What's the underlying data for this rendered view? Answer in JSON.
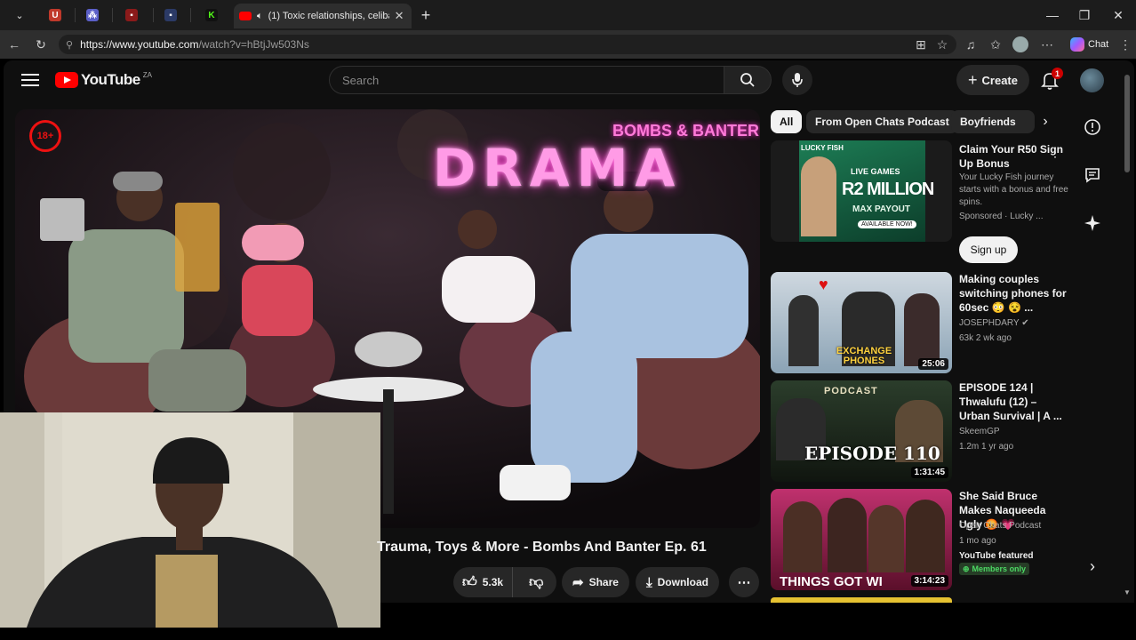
{
  "browser": {
    "active_tab_title": "(1) Toxic relationships, celiba",
    "url_host": "https://www.youtube.com",
    "url_path": "/watch?v=hBtjJw503Ns",
    "chat_label": "Chat",
    "pinned_tabs": [
      {
        "icon": "u-icon",
        "glyph": "U",
        "color": "#c0392b"
      },
      {
        "icon": "teams-icon",
        "glyph": "⁂",
        "color": "#5b5fc7"
      },
      {
        "icon": "red-app-icon",
        "glyph": "▪",
        "color": "#8b1a1a"
      },
      {
        "icon": "blue-app-icon",
        "glyph": "▪",
        "color": "#2b3a66"
      },
      {
        "icon": "kick-icon",
        "glyph": "K",
        "color": "#53fc18"
      }
    ]
  },
  "youtube": {
    "logo_text": "YouTube",
    "region": "ZA",
    "search_placeholder": "Search",
    "create_label": "Create",
    "notification_count": "1",
    "video": {
      "title": "Trauma, Toys & More - Bombs And Banter Ep. 61",
      "like_count": "5.3k",
      "share_label": "Share",
      "download_label": "Download",
      "thumb_badge": "18+",
      "thumb_headline": "DRAMA",
      "thumb_brand": "BOMBS & BANTER"
    },
    "chips": [
      "All",
      "From Open Chats Podcast",
      "Boyfriends"
    ],
    "recommendations": [
      {
        "title": "Claim Your R50 Sign Up Bonus",
        "meta1": "Your Lucky Fish journey starts with a bonus and free spins.",
        "meta2": "Sponsored · Lucky ...",
        "cta": "Sign up",
        "thumb_text_1": "LIVE GAMES",
        "thumb_text_2": "R2 MILLION",
        "thumb_text_3": "MAX PAYOUT",
        "thumb_text_4": "AVAILABLE NOW!",
        "thumb_brand": "LUCKY FISH"
      },
      {
        "title": "Making couples switching phones for 60sec 😳 😵 ...",
        "channel": "JOSEPHDARY",
        "meta": "63k  2 wk ago",
        "duration": "25:06",
        "thumb_caption": "EXCHANGE PHONES"
      },
      {
        "title": "EPISODE 124 | Thwalufu (12) – Urban Survival | A ...",
        "channel": "SkeemGP",
        "meta": "1.2m  1 yr ago",
        "duration": "1:31:45",
        "thumb_caption": "EPISODE 110",
        "thumb_top": "PODCAST"
      },
      {
        "title": "She Said Bruce Makes Naqueeda Ugly 😡 💗",
        "channel": "Open Chats Podcast",
        "meta": "1 mo ago",
        "featured": "YouTube featured",
        "members": "Members only",
        "duration": "3:14:23",
        "thumb_caption": "THINGS GOT WI"
      }
    ]
  }
}
